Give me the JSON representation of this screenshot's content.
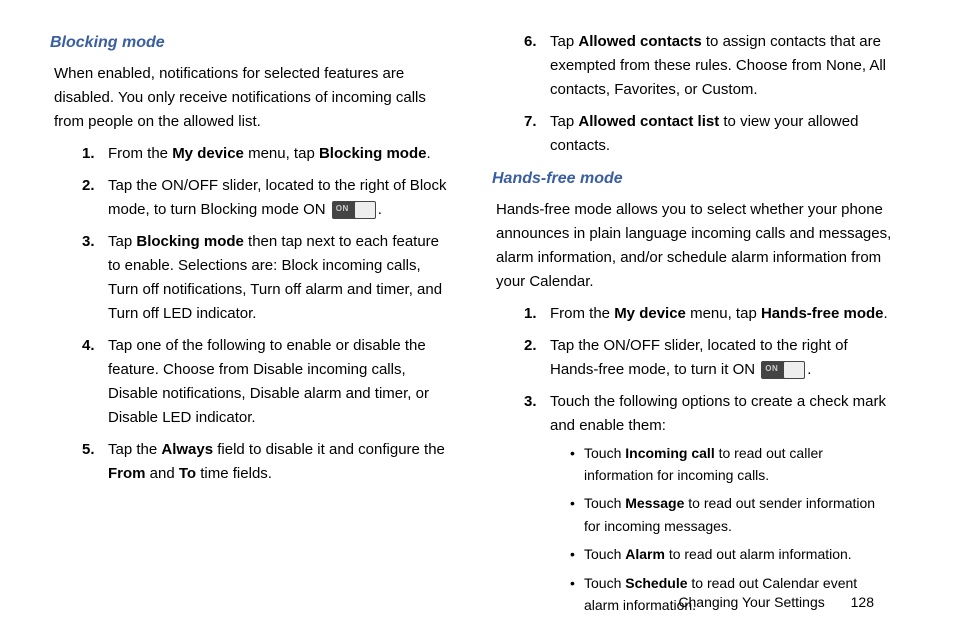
{
  "left": {
    "heading": "Blocking mode",
    "intro": "When enabled, notifications for selected features are disabled. You only receive notifications of incoming calls from people on the allowed list.",
    "steps": [
      {
        "pre": "From the ",
        "b1": "My device",
        "mid": " menu, tap ",
        "b2": "Blocking mode",
        "post": "."
      },
      {
        "pre": "Tap the ON/OFF slider, located to the right of Block mode, to turn Blocking mode ON ",
        "switch": true,
        "post": "."
      },
      {
        "pre": "Tap ",
        "b1": "Blocking mode",
        "post": " then tap next to each feature to enable. Selections are: Block incoming calls, Turn off notifications, Turn off alarm and timer, and Turn off LED indicator."
      },
      {
        "pre": "Tap one of the following to enable or disable the feature. Choose from Disable incoming calls, Disable notifications, Disable alarm and timer, or Disable LED indicator."
      },
      {
        "pre": "Tap the ",
        "b1": "Always",
        "mid": " field to disable it and configure the ",
        "b2": "From",
        "mid2": " and ",
        "b3": "To",
        "post": " time fields."
      }
    ]
  },
  "right": {
    "contSteps": [
      {
        "num": "6.",
        "pre": "Tap ",
        "b1": "Allowed contacts",
        "post": " to assign contacts that are exempted from these rules. Choose from None, All contacts, Favorites, or Custom."
      },
      {
        "num": "7.",
        "pre": "Tap ",
        "b1": "Allowed contact list",
        "post": " to view your allowed contacts."
      }
    ],
    "heading": "Hands-free mode",
    "intro": "Hands-free mode allows you to select whether your phone announces in plain language incoming calls and messages, alarm information, and/or schedule alarm information from your Calendar.",
    "steps": [
      {
        "num": "1.",
        "pre": "From the ",
        "b1": "My device",
        "mid": " menu, tap ",
        "b2": "Hands-free mode",
        "post": "."
      },
      {
        "num": "2.",
        "pre": "Tap the ON/OFF slider, located to the right of Hands-free mode, to turn it ON ",
        "switch": true,
        "post": "."
      },
      {
        "num": "3.",
        "pre": "Touch the following options to create a check mark and enable them:"
      }
    ],
    "bullets": [
      {
        "pre": "Touch ",
        "b": "Incoming call",
        "post": " to read out caller information for incoming calls."
      },
      {
        "pre": "Touch ",
        "b": "Message",
        "post": " to read out sender information for incoming messages."
      },
      {
        "pre": "Touch ",
        "b": "Alarm",
        "post": " to read out alarm information."
      },
      {
        "pre": "Touch ",
        "b": "Schedule",
        "post": " to read out Calendar event alarm information."
      }
    ]
  },
  "footer": {
    "label": "Changing Your Settings",
    "page": "128"
  },
  "switchText": "ON"
}
